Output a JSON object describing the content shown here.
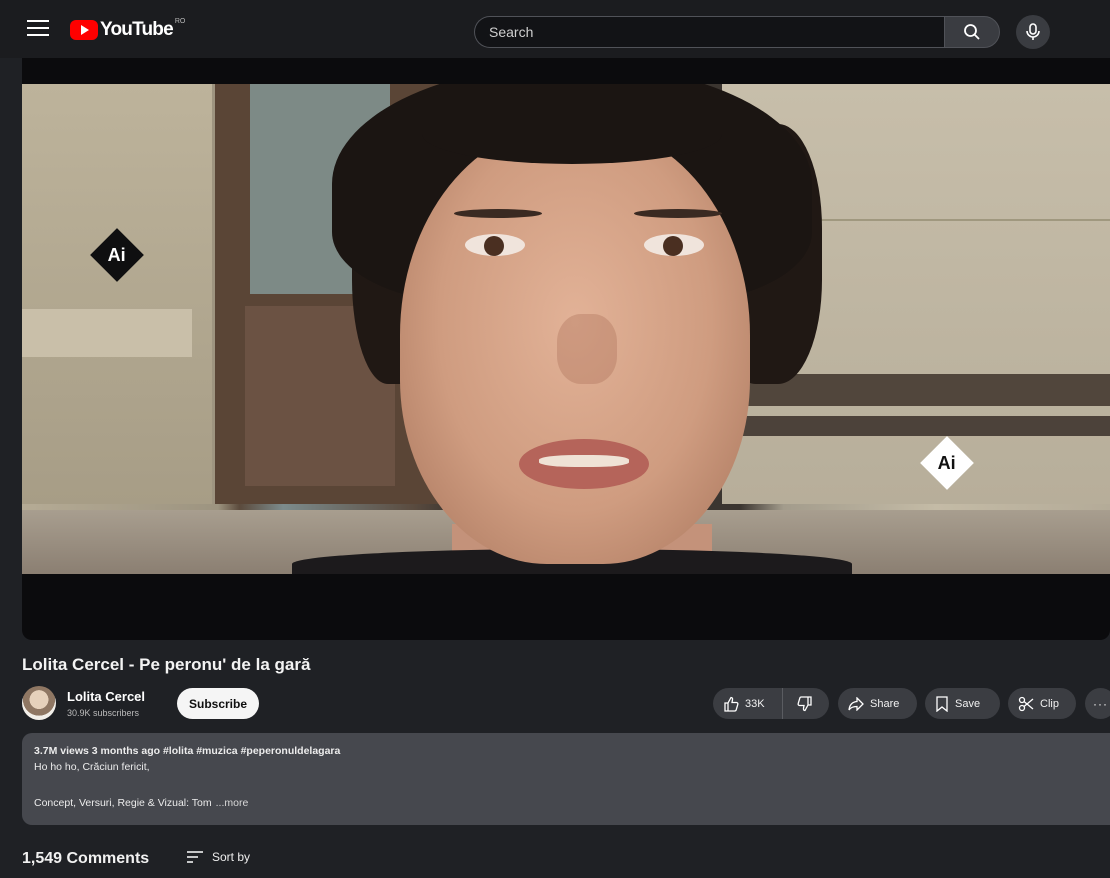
{
  "header": {
    "logo_text": "YouTube",
    "country_code": "RO",
    "search_placeholder": "Search"
  },
  "player": {
    "watermark_left": "Ai",
    "watermark_right": "Ai"
  },
  "video": {
    "title": "Lolita Cercel - Pe peronu' de la gară"
  },
  "channel": {
    "name": "Lolita Cercel",
    "subscribers": "30.9K subscribers",
    "subscribe_label": "Subscribe"
  },
  "actions": {
    "likes": "33K",
    "share_label": "Share",
    "save_label": "Save",
    "clip_label": "Clip",
    "more_label": "···"
  },
  "description": {
    "meta": "3.7M views  3 months ago  #lolita #muzica #peperonuldelagara",
    "line1": "Ho ho ho, Crăciun fericit,",
    "line2": "Concept, Versuri, Regie & Vizual: Tom",
    "more": "...more"
  },
  "comments": {
    "count_label": "1,549 Comments",
    "sort_label": "Sort by"
  },
  "colors": {
    "brand_red": "#ff0000",
    "page_bg": "#1f2125",
    "pill_bg": "#3b3d42"
  }
}
